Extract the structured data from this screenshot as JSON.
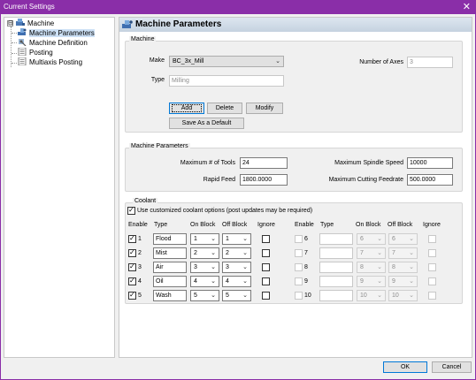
{
  "window": {
    "title": "Current Settings",
    "close_glyph": "✕"
  },
  "tree": {
    "root": {
      "label": "Machine",
      "expander": "⊟",
      "icon": "machine-icon"
    },
    "items": [
      {
        "label": "Machine Parameters",
        "icon": "machine-params-icon",
        "selected": true
      },
      {
        "label": "Machine Definition",
        "icon": "machine-definition-icon"
      },
      {
        "label": "Posting",
        "icon": "posting-icon"
      },
      {
        "label": "Multiaxis Posting",
        "icon": "multiaxis-posting-icon"
      }
    ]
  },
  "pane": {
    "title": "Machine Parameters",
    "icon": "machine-params-icon"
  },
  "machine_group": {
    "title": "Machine",
    "make_label": "Make",
    "make_value": "BC_3x_Mill",
    "type_label": "Type",
    "type_value": "Milling",
    "axes_label": "Number of Axes",
    "axes_value": "3",
    "add": "Add",
    "delete": "Delete",
    "modify": "Modify",
    "save_default": "Save As a Default"
  },
  "params_group": {
    "title": "Machine Parameters",
    "max_tools_label": "Maximum # of Tools",
    "max_tools_value": "24",
    "rapid_label": "Rapid Feed",
    "rapid_value": "1800.0000",
    "spindle_label": "Maximum Spindle Speed",
    "spindle_value": "10000",
    "cutting_label": "Maximum Cutting Feedrate",
    "cutting_value": "500.0000"
  },
  "coolant_group": {
    "title": "Coolant",
    "customize_label": "Use customized coolant options (post updates may be required)",
    "customize_checked": true,
    "headers": {
      "enable": "Enable",
      "type": "Type",
      "on": "On Block",
      "off": "Off Block",
      "ignore": "Ignore"
    },
    "left_rows": [
      {
        "num": "1",
        "type": "Flood",
        "on": "1",
        "off": "1",
        "enabled": true
      },
      {
        "num": "2",
        "type": "Mist",
        "on": "2",
        "off": "2",
        "enabled": true
      },
      {
        "num": "3",
        "type": "Air",
        "on": "3",
        "off": "3",
        "enabled": true
      },
      {
        "num": "4",
        "type": "Oil",
        "on": "4",
        "off": "4",
        "enabled": true
      },
      {
        "num": "5",
        "type": "Wash",
        "on": "5",
        "off": "5",
        "enabled": true
      }
    ],
    "right_rows": [
      {
        "num": "6",
        "type": "",
        "on": "6",
        "off": "6",
        "enabled": false
      },
      {
        "num": "7",
        "type": "",
        "on": "7",
        "off": "7",
        "enabled": false
      },
      {
        "num": "8",
        "type": "",
        "on": "8",
        "off": "8",
        "enabled": false
      },
      {
        "num": "9",
        "type": "",
        "on": "9",
        "off": "9",
        "enabled": false
      },
      {
        "num": "10",
        "type": "",
        "on": "10",
        "off": "10",
        "enabled": false
      }
    ]
  },
  "footer": {
    "ok": "OK",
    "cancel": "Cancel"
  },
  "glyphs": {
    "check": "✓",
    "chevron": "⌄"
  },
  "colors": {
    "titlebar": "#8a2ea8",
    "selection": "#cce0f5",
    "focus": "#0078d7"
  }
}
